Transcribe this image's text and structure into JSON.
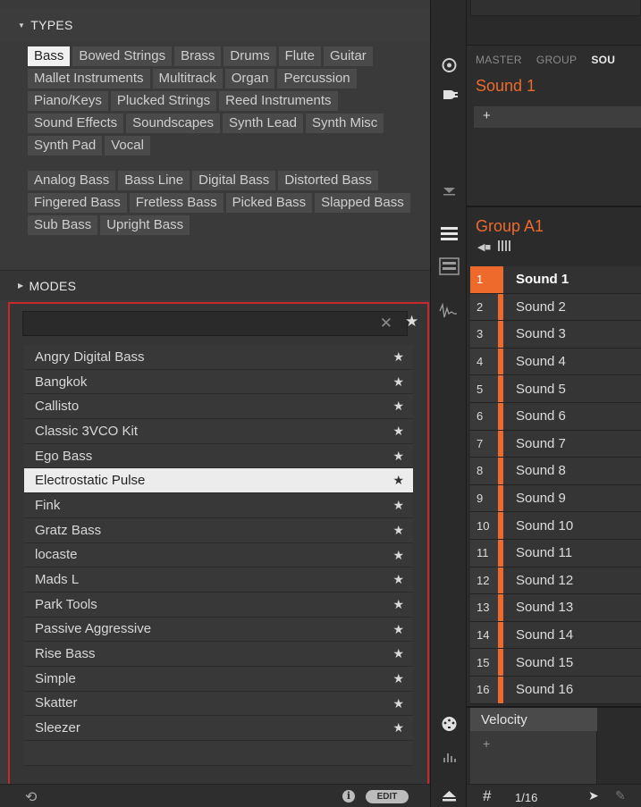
{
  "types": {
    "header": "TYPES",
    "tags": [
      {
        "label": "Bass",
        "selected": true
      },
      {
        "label": "Bowed Strings",
        "selected": false
      },
      {
        "label": "Brass",
        "selected": false
      },
      {
        "label": "Drums",
        "selected": false
      },
      {
        "label": "Flute",
        "selected": false
      },
      {
        "label": "Guitar",
        "selected": false
      },
      {
        "label": "Mallet Instruments",
        "selected": false
      },
      {
        "label": "Multitrack",
        "selected": false
      },
      {
        "label": "Organ",
        "selected": false
      },
      {
        "label": "Percussion",
        "selected": false
      },
      {
        "label": "Piano/Keys",
        "selected": false
      },
      {
        "label": "Plucked Strings",
        "selected": false
      },
      {
        "label": "Reed Instruments",
        "selected": false
      },
      {
        "label": "Sound Effects",
        "selected": false
      },
      {
        "label": "Soundscapes",
        "selected": false
      },
      {
        "label": "Synth Lead",
        "selected": false
      },
      {
        "label": "Synth Misc",
        "selected": false
      },
      {
        "label": "Synth Pad",
        "selected": false
      },
      {
        "label": "Vocal",
        "selected": false
      }
    ],
    "subtypes": [
      "Analog Bass",
      "Bass Line",
      "Digital Bass",
      "Distorted Bass",
      "Fingered Bass",
      "Fretless Bass",
      "Picked Bass",
      "Slapped Bass",
      "Sub Bass",
      "Upright Bass"
    ]
  },
  "modes": {
    "header": "MODES"
  },
  "search": {
    "value": "",
    "placeholder": ""
  },
  "results": [
    {
      "name": "Angry Digital Bass",
      "selected": false
    },
    {
      "name": "Bangkok",
      "selected": false
    },
    {
      "name": "Callisto",
      "selected": false
    },
    {
      "name": "Classic 3VCO Kit",
      "selected": false
    },
    {
      "name": "Ego Bass",
      "selected": false
    },
    {
      "name": "Electrostatic Pulse",
      "selected": true
    },
    {
      "name": "Fink",
      "selected": false
    },
    {
      "name": "Gratz Bass",
      "selected": false
    },
    {
      "name": "locaste",
      "selected": false
    },
    {
      "name": "Mads L",
      "selected": false
    },
    {
      "name": "Park Tools",
      "selected": false
    },
    {
      "name": "Passive Aggressive",
      "selected": false
    },
    {
      "name": "Rise Bass",
      "selected": false
    },
    {
      "name": "Simple",
      "selected": false
    },
    {
      "name": "Skatter",
      "selected": false
    },
    {
      "name": "Sleezer",
      "selected": false
    }
  ],
  "footer_left": {
    "info": "i",
    "edit_label": "EDIT"
  },
  "master": {
    "tabs": [
      {
        "label": "MASTER",
        "active": false
      },
      {
        "label": "GROUP",
        "active": false
      },
      {
        "label": "SOU",
        "active": true
      }
    ],
    "title": "Sound 1",
    "slot_plus": "+"
  },
  "group": {
    "title": "Group A1",
    "sounds": [
      {
        "num": "1",
        "name": "Sound 1",
        "active": true
      },
      {
        "num": "2",
        "name": "Sound 2",
        "active": false
      },
      {
        "num": "3",
        "name": "Sound 3",
        "active": false
      },
      {
        "num": "4",
        "name": "Sound 4",
        "active": false
      },
      {
        "num": "5",
        "name": "Sound 5",
        "active": false
      },
      {
        "num": "6",
        "name": "Sound 6",
        "active": false
      },
      {
        "num": "7",
        "name": "Sound 7",
        "active": false
      },
      {
        "num": "8",
        "name": "Sound 8",
        "active": false
      },
      {
        "num": "9",
        "name": "Sound 9",
        "active": false
      },
      {
        "num": "10",
        "name": "Sound 10",
        "active": false
      },
      {
        "num": "11",
        "name": "Sound 11",
        "active": false
      },
      {
        "num": "12",
        "name": "Sound 12",
        "active": false
      },
      {
        "num": "13",
        "name": "Sound 13",
        "active": false
      },
      {
        "num": "14",
        "name": "Sound 14",
        "active": false
      },
      {
        "num": "15",
        "name": "Sound 15",
        "active": false
      },
      {
        "num": "16",
        "name": "Sound 16",
        "active": false
      }
    ]
  },
  "velocity": {
    "label": "Velocity",
    "plus": "+"
  },
  "footer_right": {
    "step": "1/16"
  },
  "colors": {
    "accent": "#ee6a2c",
    "highlight_border": "#c8282a",
    "panel": "#3a3a3a"
  }
}
